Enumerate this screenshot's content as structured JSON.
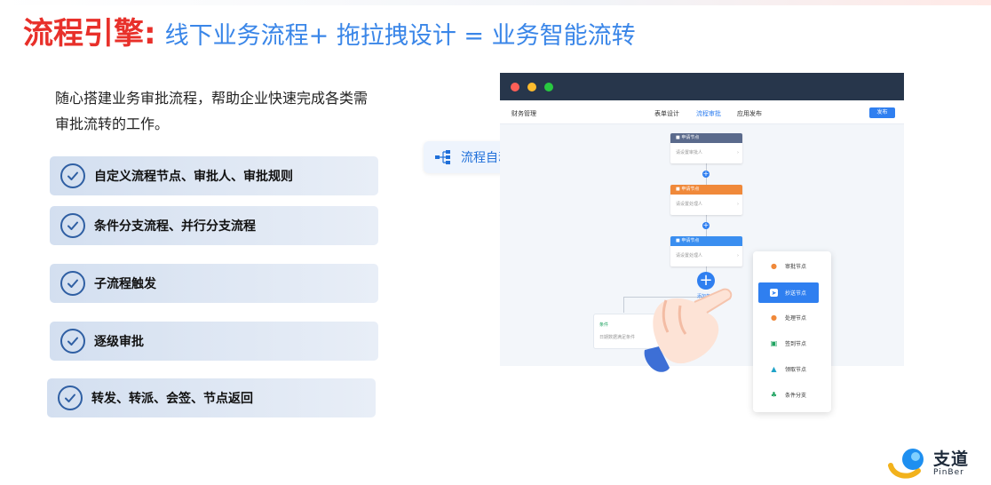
{
  "header": {
    "brand": "流程引擎:",
    "tagline": "线下业务流程+ 拖拉拽设计 = 业务智能流转"
  },
  "intro": {
    "text": "随心搭建业务审批流程，帮助企业快速完成各类需审批流转的工作。"
  },
  "features": [
    {
      "label": "自定义流程节点、审批人、审批规则"
    },
    {
      "label": "条件分支流程、并行分支流程"
    },
    {
      "label": "子流程触发"
    },
    {
      "label": "逐级审批"
    },
    {
      "label": "转发、转派、会签、节点返回"
    }
  ],
  "badge": {
    "label": "流程自动化",
    "icon": "flow-branch-icon"
  },
  "app": {
    "nav_left": "财务管理",
    "tabs": [
      {
        "label": "表单设计"
      },
      {
        "label": "流程审批"
      },
      {
        "label": "应用发布"
      }
    ],
    "active_tab": "流程审批",
    "publish_label": "发布",
    "nodes": [
      {
        "title": "申请节点",
        "placeholder": "请设置审批人",
        "color": "#5a6a8c"
      },
      {
        "title": "申请节点",
        "placeholder": "请设置处理人",
        "color": "#f0893a"
      },
      {
        "title": "申请节点",
        "placeholder": "请设置处理人",
        "color": "#3a8ef0"
      }
    ],
    "add_condition": "添加条件",
    "condition": {
      "title": "条件",
      "desc": "日期数据满足条件"
    },
    "menu": [
      {
        "label": "审批节点",
        "icon": "user-icon",
        "color": "#f0893a"
      },
      {
        "label": "抄送节点",
        "icon": "send-icon",
        "color": "#ffffff"
      },
      {
        "label": "处理节点",
        "icon": "user-gear-icon",
        "color": "#f0893a"
      },
      {
        "label": "签到节点",
        "icon": "calendar-icon",
        "color": "#1fa360"
      },
      {
        "label": "领取节点",
        "icon": "hand-icon",
        "color": "#1fa3c8"
      },
      {
        "label": "条件分支",
        "icon": "branch-icon",
        "color": "#1fa360"
      }
    ],
    "menu_selected": "抄送节点"
  },
  "logo": {
    "name": "支道",
    "sub": "PinBer"
  },
  "colors": {
    "brand_red": "#e8302a",
    "accent_blue": "#3a86e8",
    "check_blue": "#2f5fa3",
    "primary": "#2f7ff0"
  }
}
